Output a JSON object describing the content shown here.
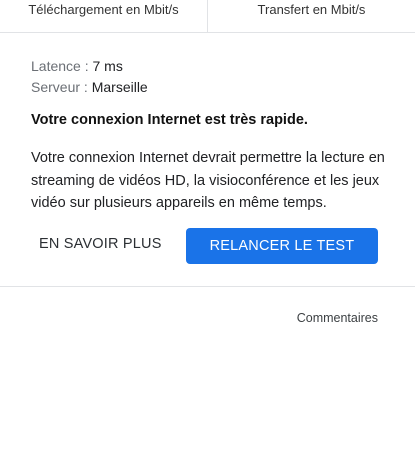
{
  "units": {
    "download_label": "Téléchargement en Mbit/s",
    "upload_label": "Transfert en Mbit/s"
  },
  "details": {
    "latency_key": "Latence : ",
    "latency_value": "7 ms",
    "server_key": "Serveur : ",
    "server_value": "Marseille"
  },
  "result": {
    "headline": "Votre connexion Internet est très rapide.",
    "description": "Votre connexion Internet devrait permettre la lecture en streaming de vidéos HD, la visioconférence et les jeux vidéo sur plusieurs appareils en même temps."
  },
  "actions": {
    "learn_more_label": "EN SAVOIR PLUS",
    "retest_label": "RELANCER LE TEST"
  },
  "footer": {
    "feedback_label": "Commentaires"
  },
  "colors": {
    "accent": "#1a73e8",
    "divider": "#e1e3e6"
  }
}
